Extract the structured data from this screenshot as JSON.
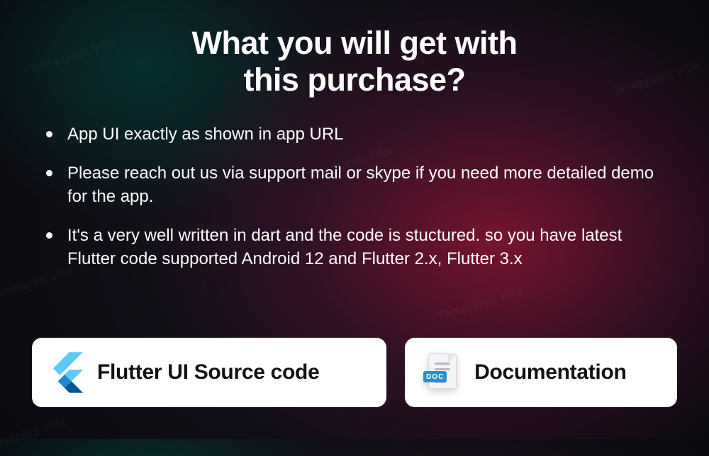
{
  "watermark_text": "Templates villa",
  "heading_line1": "What you will get with",
  "heading_line2": "this purchase?",
  "bullets": [
    "App UI exactly as shown in app URL",
    "Please reach out us via support mail or skype if you need more detailed demo for the app.",
    "It's a very well written in dart and the code is stuctured. so you have latest Flutter code supported Android 12  and Flutter 2.x, Flutter 3.x"
  ],
  "cards": {
    "flutter_label": "Flutter UI Source code",
    "doc_label": "Documentation",
    "doc_badge": "DOC"
  },
  "colors": {
    "card_bg": "#ffffff",
    "text_light": "#ffffff",
    "flutter_light": "#5ec8f8",
    "flutter_dark": "#075698",
    "doc_badge_bg": "#1f93d6"
  }
}
